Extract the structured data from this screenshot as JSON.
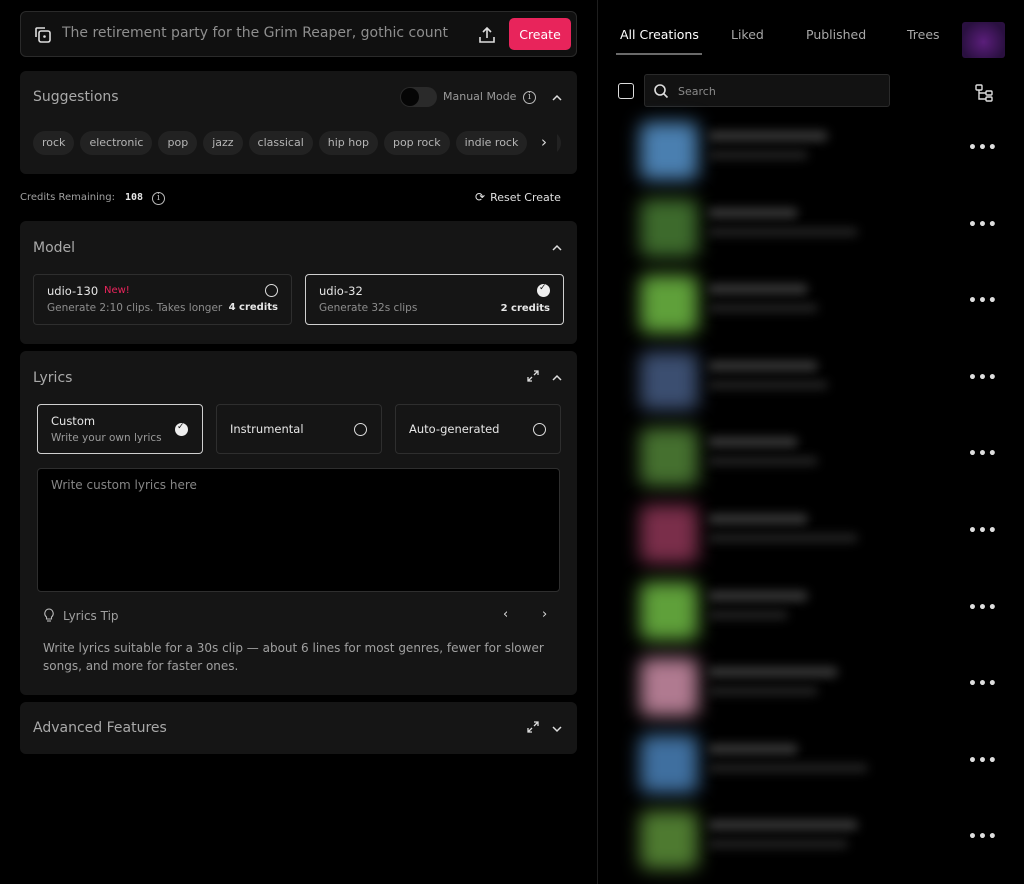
{
  "prompt": {
    "value": "The retirement party for the Grim Reaper, gothic count",
    "create_label": "Create"
  },
  "suggestions": {
    "title": "Suggestions",
    "manual_mode_label": "Manual Mode",
    "manual_mode_on": false,
    "chips": [
      "rock",
      "electronic",
      "pop",
      "jazz",
      "classical",
      "hip hop",
      "pop rock",
      "indie rock",
      "al"
    ]
  },
  "credits": {
    "label": "Credits Remaining:",
    "value": "108",
    "reset_label": "Reset Create"
  },
  "model": {
    "title": "Model",
    "options": [
      {
        "name": "udio-130",
        "badge": "New!",
        "desc": "Generate 2:10 clips. Takes longer",
        "credits": "4 credits",
        "selected": false
      },
      {
        "name": "udio-32",
        "badge": "",
        "desc": "Generate 32s clips",
        "credits": "2 credits",
        "selected": true
      }
    ]
  },
  "lyrics": {
    "title": "Lyrics",
    "options": [
      {
        "title": "Custom",
        "sub": "Write your own lyrics",
        "selected": true
      },
      {
        "title": "Instrumental",
        "sub": "",
        "selected": false
      },
      {
        "title": "Auto-generated",
        "sub": "",
        "selected": false
      }
    ],
    "placeholder": "Write custom lyrics here",
    "tip_label": "Lyrics Tip",
    "tip_text": "Write lyrics suitable for a 30s clip — about 6 lines for most genres, fewer for slower songs, and more for faster ones."
  },
  "advanced": {
    "title": "Advanced Features"
  },
  "library": {
    "tabs": [
      "All Creations",
      "Liked",
      "Published",
      "Trees"
    ],
    "active_tab": "All Creations",
    "search_placeholder": "Search",
    "rows": [
      {
        "thumb": "#4a7fb0"
      },
      {
        "thumb": "#3d6a2c"
      },
      {
        "thumb": "#5fa03a"
      },
      {
        "thumb": "#3b4e70"
      },
      {
        "thumb": "#45702f"
      },
      {
        "thumb": "#7a2e4a"
      },
      {
        "thumb": "#5fa03a"
      },
      {
        "thumb": "#b07a90"
      },
      {
        "thumb": "#3f6f9f"
      },
      {
        "thumb": "#4e7a30"
      }
    ]
  },
  "colors": {
    "accent": "#e8245b",
    "panel": "#151515",
    "background": "#000000"
  }
}
